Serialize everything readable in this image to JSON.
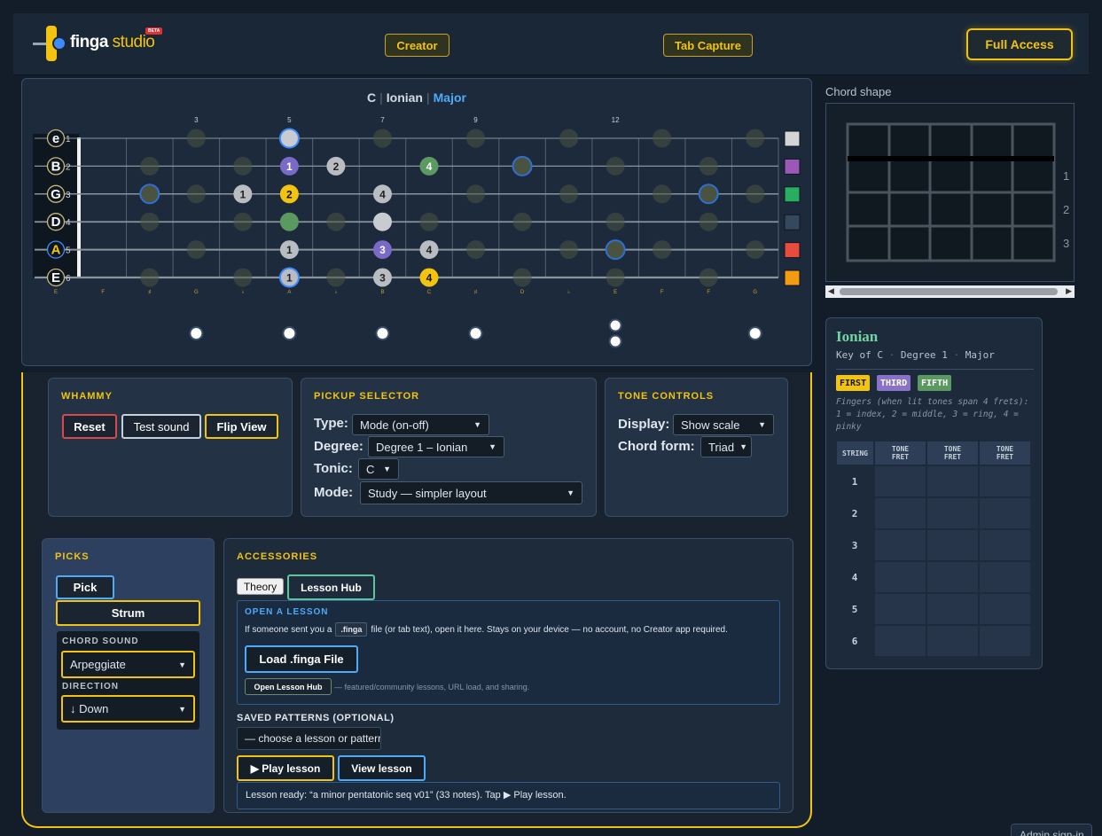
{
  "header": {
    "logo_word": "finga",
    "logo_word2": "studio",
    "beta": "BETA",
    "creator_label": "Creator",
    "tab_capture_label": "Tab Capture",
    "full_access_label": "Full Access"
  },
  "fretboard": {
    "title_key": "C",
    "title_scale": "Ionian",
    "title_mode": "Major",
    "fret_markers": [
      "3",
      "5",
      "7",
      "9",
      "12"
    ],
    "string_labels": [
      {
        "note": "e",
        "num": "1"
      },
      {
        "note": "B",
        "num": "2"
      },
      {
        "note": "G",
        "num": "3"
      },
      {
        "note": "D",
        "num": "4"
      },
      {
        "note": "A",
        "num": "5"
      },
      {
        "note": "E",
        "num": "6"
      }
    ],
    "bottom_notes": [
      "E",
      "F",
      "♯",
      "G",
      "♭",
      "A",
      "♭",
      "B",
      "C",
      "♯",
      "D",
      "♭",
      "E",
      "F",
      "F",
      "G"
    ],
    "string_colors": [
      "#d4d4d4",
      "#9b59b6",
      "#27ae60",
      "#34495e",
      "#e74c3c",
      "#f39c12"
    ],
    "dots": [
      {
        "s": 1,
        "f": 5,
        "t": "",
        "kind": "root-ring"
      },
      {
        "s": 2,
        "f": 5,
        "t": "1",
        "kind": "purple"
      },
      {
        "s": 2,
        "f": 6,
        "t": "2",
        "kind": "grey"
      },
      {
        "s": 2,
        "f": 8,
        "t": "4",
        "kind": "green"
      },
      {
        "s": 2,
        "f": 10,
        "t": "",
        "kind": "ring"
      },
      {
        "s": 3,
        "f": 2,
        "t": "",
        "kind": "ring"
      },
      {
        "s": 3,
        "f": 4,
        "t": "1",
        "kind": "grey"
      },
      {
        "s": 3,
        "f": 5,
        "t": "2",
        "kind": "yellow"
      },
      {
        "s": 3,
        "f": 7,
        "t": "4",
        "kind": "grey"
      },
      {
        "s": 3,
        "f": 14,
        "t": "",
        "kind": "ring"
      },
      {
        "s": 4,
        "f": 5,
        "t": "",
        "kind": "green"
      },
      {
        "s": 4,
        "f": 7,
        "t": "",
        "kind": "white"
      },
      {
        "s": 5,
        "f": 5,
        "t": "1",
        "kind": "grey"
      },
      {
        "s": 5,
        "f": 7,
        "t": "3",
        "kind": "purple"
      },
      {
        "s": 5,
        "f": 8,
        "t": "4",
        "kind": "grey"
      },
      {
        "s": 5,
        "f": 12,
        "t": "",
        "kind": "ring"
      },
      {
        "s": 6,
        "f": 5,
        "t": "1",
        "kind": "grey-ring"
      },
      {
        "s": 6,
        "f": 7,
        "t": "3",
        "kind": "grey"
      },
      {
        "s": 6,
        "f": 8,
        "t": "4",
        "kind": "yellow"
      }
    ]
  },
  "whammy": {
    "title": "WHAMMY",
    "reset": "Reset",
    "test_sound": "Test sound",
    "flip_view": "Flip View"
  },
  "pickup": {
    "title": "PICKUP SELECTOR",
    "type_label": "Type:",
    "type_value": "Mode (on-off)",
    "degree_label": "Degree:",
    "degree_value": "Degree 1 – Ionian",
    "tonic_label": "Tonic:",
    "tonic_value": "C",
    "mode_label": "Mode:",
    "mode_value": "Study — simpler layout"
  },
  "tone": {
    "title": "TONE CONTROLS",
    "display_label": "Display:",
    "display_value": "Show scale",
    "chord_form_label": "Chord form:",
    "chord_form_value": "Triad"
  },
  "picks": {
    "title": "PICKS",
    "pick": "Pick",
    "strum": "Strum",
    "chord_sound_label": "CHORD SOUND",
    "chord_sound_value": "Arpeggiate",
    "direction_label": "DIRECTION",
    "direction_value": "↓ Down"
  },
  "accessories": {
    "title": "ACCESSORIES",
    "tab_theory": "Theory",
    "tab_lesson_hub": "Lesson Hub",
    "open_title": "OPEN A LESSON",
    "open_text_1": "If someone sent you a",
    "open_code": ".finga",
    "open_text_2": "file (or tab text), open it here. Stays on your device — no account, no Creator app required.",
    "load_button": "Load .finga File",
    "hub_button": "Open Lesson Hub",
    "hub_text": "— featured/community lessons, URL load, and sharing.",
    "saved_label": "SAVED PATTERNS (OPTIONAL)",
    "saved_value": "— choose a lesson or pattern —",
    "play_button": "▶ Play lesson",
    "view_button": "View lesson",
    "status": "Lesson ready: “a minor pentatonic seq v01” (33 notes). Tap ▶ Play lesson."
  },
  "chord_shape": {
    "label": "Chord shape",
    "fret_numbers": [
      "1",
      "2",
      "3"
    ]
  },
  "ionian": {
    "name": "Ionian",
    "sub_key": "Key of C",
    "sub_degree": "Degree 1",
    "sub_mode": "Major",
    "dot": "·",
    "badge_first": "FIRST",
    "badge_third": "THIRD",
    "badge_fifth": "FIFTH",
    "note": "Fingers (when lit tones span 4 frets): 1 = index, 2 = middle, 3 = ring, 4 = pinky",
    "col_string": "STRING",
    "col_tone_1": "TONE",
    "col_fret_1": "FRET",
    "col_tone_2": "TONE",
    "col_fret_2": "FRET",
    "col_tone_3": "TONE",
    "col_fret_3": "FRET",
    "rows": [
      "1",
      "2",
      "3",
      "4",
      "5",
      "6"
    ]
  },
  "footer": {
    "admin": "Admin sign-in"
  },
  "colors": {
    "accent": "#f2c30f",
    "blue": "#4dabf7",
    "green_text": "#74d4a0"
  }
}
